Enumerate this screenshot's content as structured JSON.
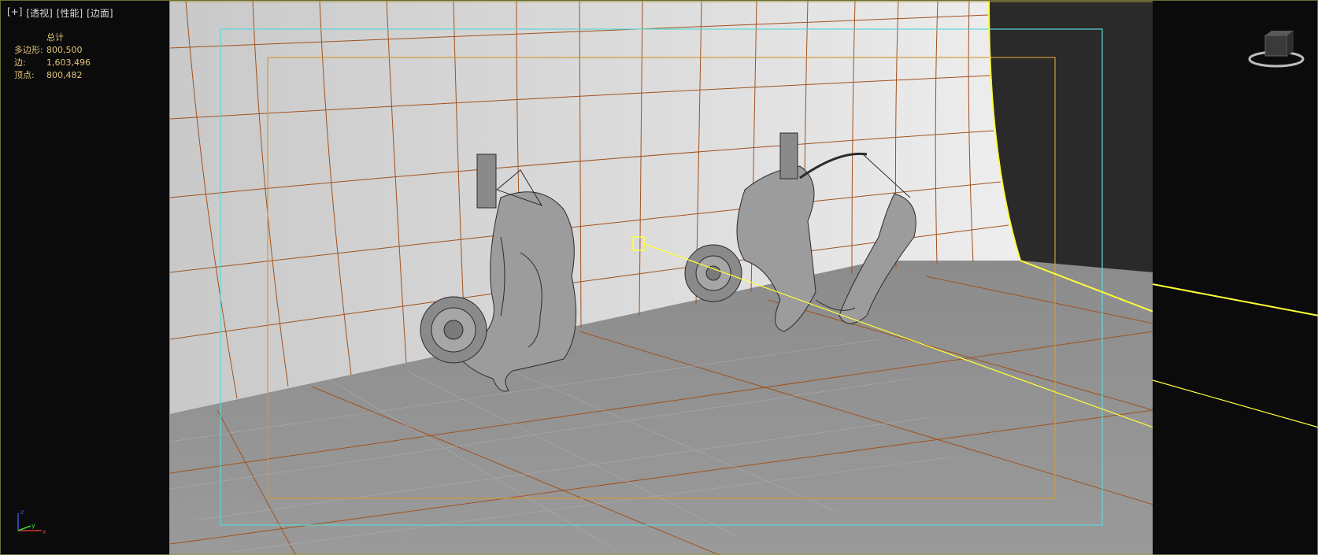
{
  "viewport": {
    "labels": [
      "[+]",
      "[透视]",
      "[性能]",
      "[边面]"
    ]
  },
  "stats": {
    "header": "总计",
    "rows": [
      {
        "key": "多边形:",
        "value": "800,500"
      },
      {
        "key": "边:",
        "value": "1,603,496"
      },
      {
        "key": "顶点:",
        "value": "800,482"
      }
    ]
  },
  "icons": {
    "viewcube": "viewcube-icon",
    "axis": "axis-tripod-icon",
    "light_target": "light-target-icon"
  },
  "axis_labels": {
    "x": "x",
    "y": "y",
    "z": "z"
  },
  "colors": {
    "accent_yellow": "#ffff3a",
    "safe_frame_cyan": "#5fd6d6",
    "safe_frame_orange": "#d09a3a",
    "grid_orange": "#a0521e",
    "label_text": "#d8d8d8",
    "stat_text": "#e0c27a"
  }
}
